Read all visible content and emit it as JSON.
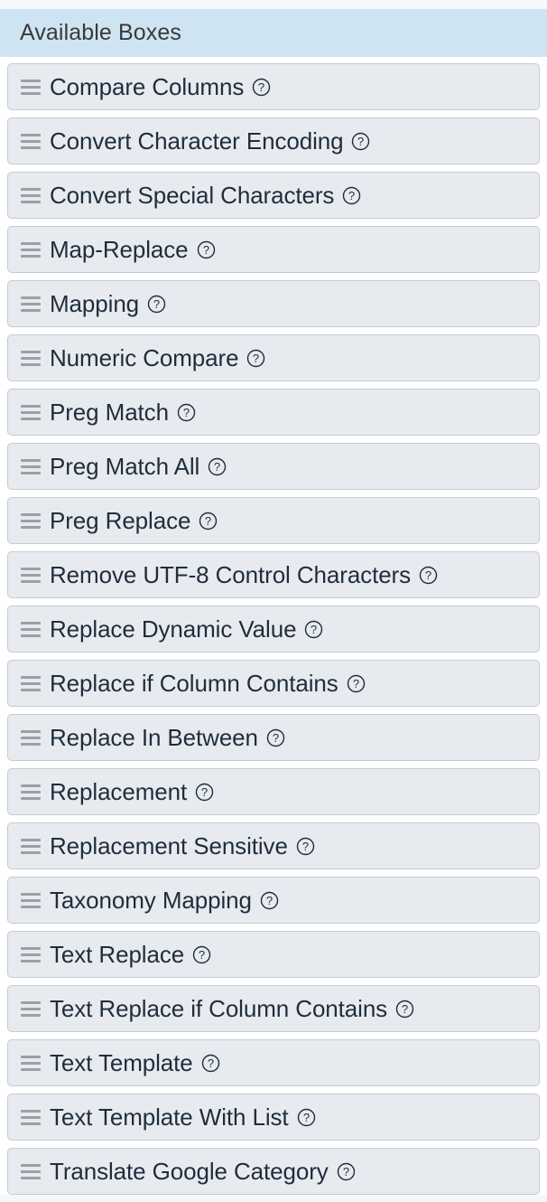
{
  "panel": {
    "header": {
      "title": "Available Boxes",
      "background_color": "#cfe4f3"
    },
    "item_background_color": "#e7ebef",
    "item_border_color": "#c6cbd1",
    "item_text_color": "#1f2d3d",
    "drag_handle_color": "#9aa0a6",
    "drag_handle_icon": "drag-handle-icon",
    "help_icon": "help-circle-icon",
    "items": [
      {
        "label": "Compare Columns"
      },
      {
        "label": "Convert Character Encoding"
      },
      {
        "label": "Convert Special Characters"
      },
      {
        "label": "Map-Replace"
      },
      {
        "label": "Mapping"
      },
      {
        "label": "Numeric Compare"
      },
      {
        "label": "Preg Match"
      },
      {
        "label": "Preg Match All"
      },
      {
        "label": "Preg Replace"
      },
      {
        "label": "Remove UTF-8 Control Characters"
      },
      {
        "label": "Replace Dynamic Value"
      },
      {
        "label": "Replace if Column Contains"
      },
      {
        "label": "Replace In Between"
      },
      {
        "label": "Replacement"
      },
      {
        "label": "Replacement Sensitive"
      },
      {
        "label": "Taxonomy Mapping"
      },
      {
        "label": "Text Replace"
      },
      {
        "label": "Text Replace if Column Contains"
      },
      {
        "label": "Text Template"
      },
      {
        "label": "Text Template With List"
      },
      {
        "label": "Translate Google Category"
      }
    ]
  }
}
